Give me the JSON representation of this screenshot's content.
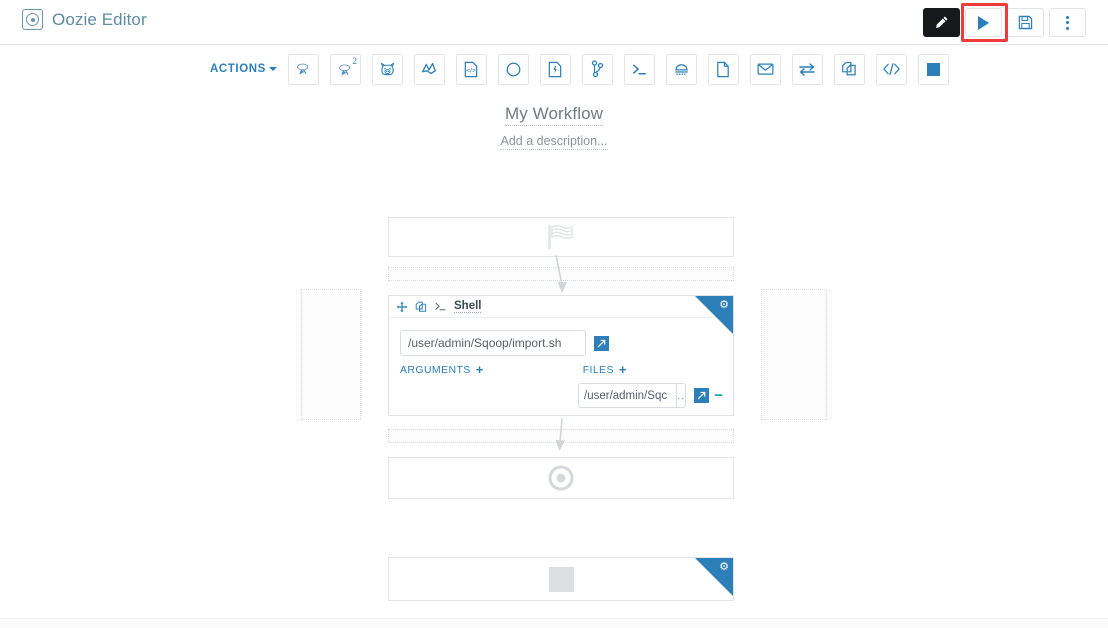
{
  "header": {
    "app_title": "Oozie Editor",
    "logo_icon": "oozie-circle-icon",
    "buttons": [
      {
        "name": "edit-button",
        "icon": "pencil-icon",
        "label": ""
      },
      {
        "name": "run-button",
        "icon": "play-icon",
        "label": ""
      },
      {
        "name": "save-button",
        "icon": "floppy-disk-icon",
        "label": ""
      },
      {
        "name": "more-button",
        "icon": "vertical-dots-icon",
        "label": ""
      }
    ],
    "highlighted_button": "run-button",
    "highlight_color": "#ee3b3b"
  },
  "toolbar": {
    "actions_label": "ACTIONS",
    "actions_caret": "caret-down-icon",
    "items": [
      {
        "name": "action-hive",
        "icon": "hive-bee-icon",
        "sup": ""
      },
      {
        "name": "action-hive2",
        "icon": "hive-bee-icon",
        "sup": "2"
      },
      {
        "name": "action-pig",
        "icon": "pig-icon",
        "sup": ""
      },
      {
        "name": "action-sqoop",
        "icon": "sqoop-icon",
        "sup": ""
      },
      {
        "name": "action-java",
        "icon": "code-document-icon",
        "sup": ""
      },
      {
        "name": "action-mapreduce",
        "icon": "circle-icon",
        "sup": ""
      },
      {
        "name": "action-spark",
        "icon": "spark-doc-icon",
        "sup": ""
      },
      {
        "name": "action-fork",
        "icon": "fork-branch-icon",
        "sup": ""
      },
      {
        "name": "action-shell",
        "icon": "shell-prompt-icon",
        "sup": ""
      },
      {
        "name": "action-distcp",
        "icon": "distcp-icon",
        "sup": ""
      },
      {
        "name": "action-fs",
        "icon": "document-icon",
        "sup": ""
      },
      {
        "name": "action-email",
        "icon": "envelope-icon",
        "sup": ""
      },
      {
        "name": "action-subworkflow",
        "icon": "transfer-arrows-icon",
        "sup": ""
      },
      {
        "name": "action-copy",
        "icon": "copy-icon",
        "sup": ""
      },
      {
        "name": "action-generic",
        "icon": "code-brackets-icon",
        "sup": ""
      },
      {
        "name": "action-kill",
        "icon": "filled-square-icon",
        "sup": ""
      }
    ]
  },
  "workflow": {
    "title": "My Workflow",
    "description_placeholder": "Add a description..."
  },
  "graph": {
    "start_node": {
      "name": "start-node",
      "icon": "checkered-flag-icon"
    },
    "end_node": {
      "name": "end-node",
      "icon": "bullseye-icon"
    },
    "kill_node": {
      "name": "kill-node",
      "icon": "filled-square-icon"
    },
    "shell_node": {
      "name": "shell-node",
      "icon": "shell-prompt-icon",
      "label": "Shell",
      "move_icon": "move-arrows-icon",
      "copy_icon": "copy-icon",
      "close_icon": "close-icon",
      "settings_icon": "gear-icon",
      "command_value": "/user/admin/Sqoop/import.sh",
      "command_placeholder": "",
      "expand_icon": "expand-icon",
      "arguments_label": "ARGUMENTS",
      "arguments_add": "+",
      "files_label": "FILES",
      "files_add": "+",
      "file_value": "/user/admin/Sqc",
      "file_browse_label": "..",
      "file_expand_icon": "expand-icon",
      "file_remove_icon": "minus-icon"
    }
  },
  "colors": {
    "accent": "#2c7fb8",
    "brand": "#5f8ba3",
    "highlight": "#ee3b3b",
    "teal": "#19a0a0"
  }
}
